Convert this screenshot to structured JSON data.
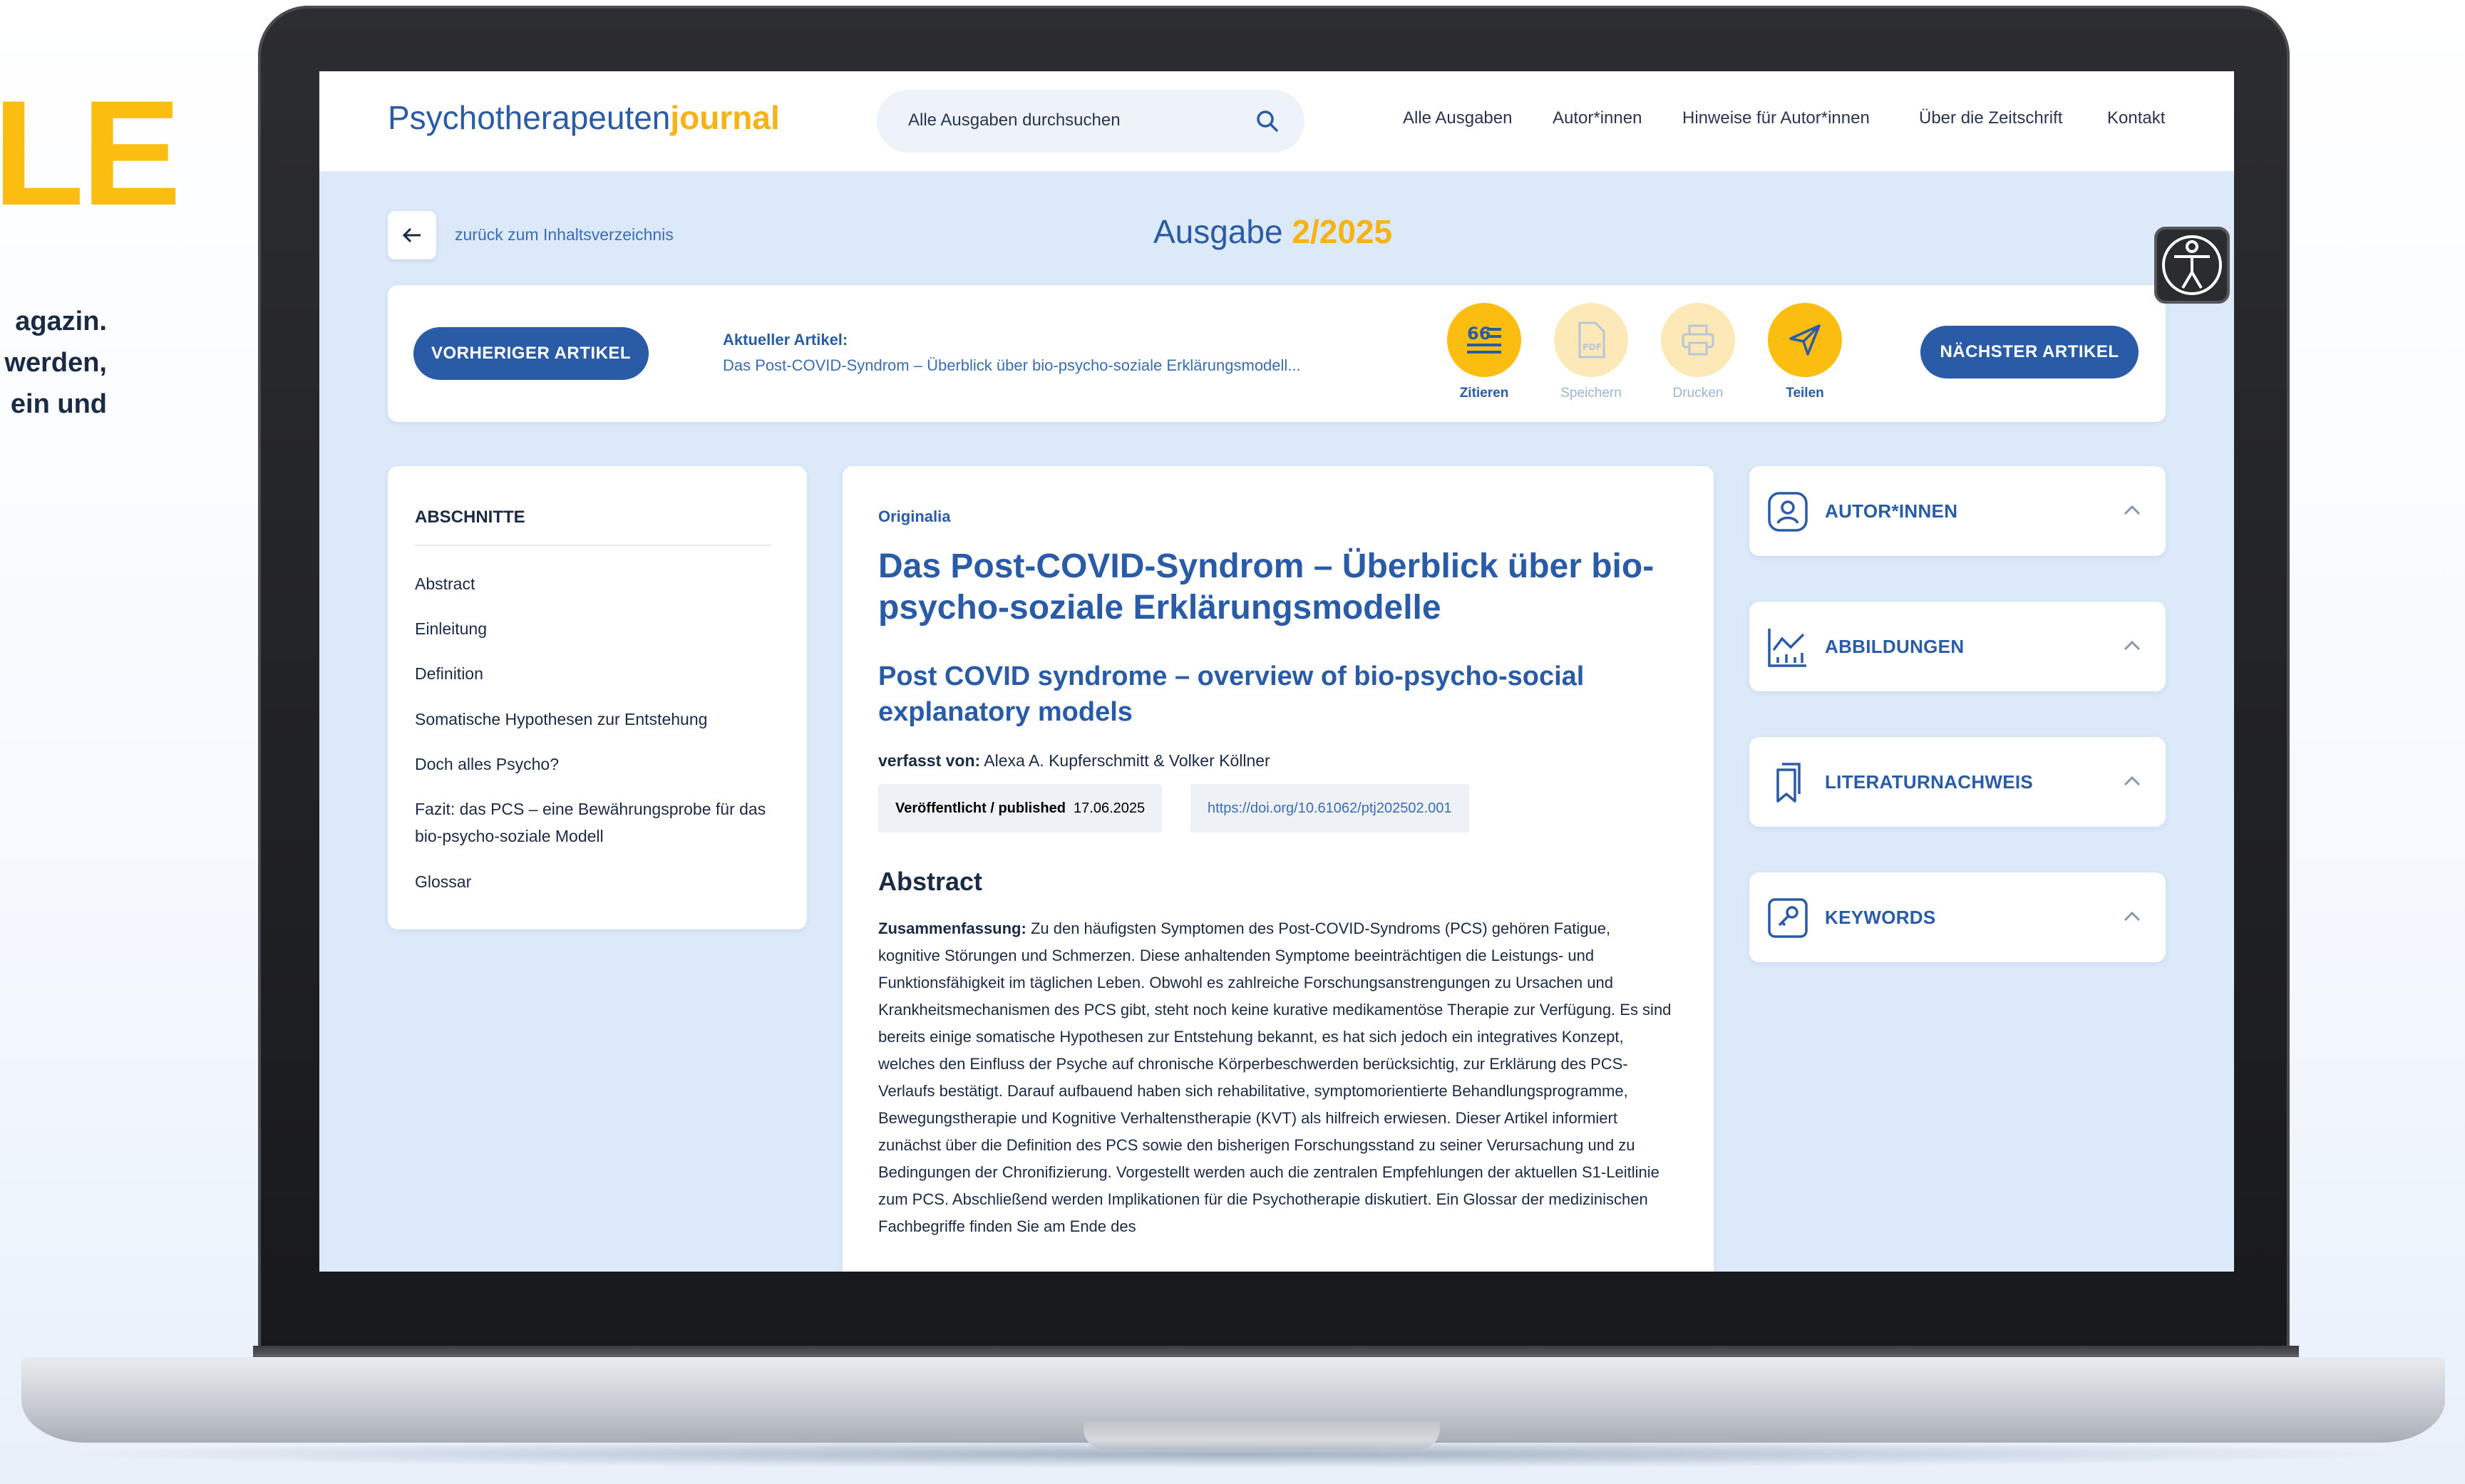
{
  "promo": {
    "title_fragment": "LE",
    "text_lines": [
      "agazin.",
      "werden,",
      "ein und"
    ]
  },
  "header": {
    "logo_main": "Psychotherapeuten",
    "logo_accent": "journal",
    "search_placeholder": "Alle Ausgaben durchsuchen",
    "nav": [
      "Alle Ausgaben",
      "Autor*innen",
      "Hinweise für Autor*innen",
      "Über die Zeitschrift",
      "Kontakt"
    ]
  },
  "issue_bar": {
    "back_label": "zurück zum Inhaltsverzeichnis",
    "issue_prefix": "Ausgabe",
    "issue_number": "2/2025"
  },
  "article_nav": {
    "prev_label": "VORHERIGER ARTIKEL",
    "next_label": "NÄCHSTER ARTIKEL",
    "current_label": "Aktueller Artikel:",
    "current_title": "Das Post-COVID-Syndrom – Überblick über bio-psycho-soziale Erklärungsmodell...",
    "actions": [
      {
        "label": "Zitieren",
        "icon": "quote-icon",
        "enabled": true
      },
      {
        "label": "Speichern",
        "icon": "pdf-icon",
        "enabled": false
      },
      {
        "label": "Drucken",
        "icon": "printer-icon",
        "enabled": false
      },
      {
        "label": "Teilen",
        "icon": "send-icon",
        "enabled": true
      }
    ]
  },
  "toc": {
    "heading": "ABSCHNITTE",
    "items": [
      "Abstract",
      "Einleitung",
      "Definition",
      "Somatische Hypothesen zur Entstehung",
      "Doch alles Psycho?",
      "Fazit: das PCS – eine Bewährungsprobe für das bio-psycho-soziale Modell",
      "Glossar"
    ]
  },
  "article": {
    "rubric": "Originalia",
    "title": "Das Post-COVID-Syndrom – Überblick über bio-psycho-soziale Erklärungsmodelle",
    "subtitle": "Post COVID syndrome – overview of bio-psycho-social explanatory models",
    "authors_label": "verfasst von:",
    "authors": "Alexa A. Kupferschmitt & Volker Köllner",
    "published_label": "Veröffentlicht / published",
    "published_date": "17.06.2025",
    "doi": "https://doi.org/10.61062/ptj202502.001",
    "abstract_heading": "Abstract",
    "abstract_lead": "Zusammenfassung:",
    "abstract_text": "Zu den häufigsten Symptomen des Post-COVID-Syndroms (PCS) gehören Fatigue, kognitive Störungen und Schmerzen. Diese anhaltenden Symptome beeinträchtigen die Leistungs- und Funktionsfähigkeit im täglichen Leben. Obwohl es zahlreiche Forschungsanstrengungen zu Ursachen und Krankheitsmechanismen des PCS gibt, steht noch keine kurative medikamentöse Therapie zur Verfügung. Es sind bereits einige somatische Hypothesen zur Entstehung bekannt, es hat sich jedoch ein integratives Konzept, welches den Einfluss der Psyche auf chronische Körperbeschwerden berücksichtig, zur Erklärung des PCS-Verlaufs bestätigt. Darauf aufbauend haben sich rehabilitative, symptomorientierte Behandlungsprogramme, Bewegungstherapie und Kognitive Verhaltenstherapie (KVT) als hilfreich erwiesen. Dieser Artikel informiert zunächst über die Definition des PCS sowie den bisherigen Forschungsstand zu seiner Verursachung und zu Bedingungen der Chronifizierung. Vorgestellt werden auch die zentralen Empfehlungen der aktuellen S1-Leitlinie zum PCS. Abschließend werden Implikationen für die Psychotherapie diskutiert. Ein Glossar der medizinischen Fachbegriffe finden Sie am Ende des"
  },
  "sidebar": [
    {
      "label": "AUTOR*INNEN",
      "icon": "user-icon"
    },
    {
      "label": "ABBILDUNGEN",
      "icon": "chart-icon"
    },
    {
      "label": "LITERATURNACHWEIS",
      "icon": "bookmark-icon"
    },
    {
      "label": "KEYWORDS",
      "icon": "key-icon"
    }
  ],
  "colors": {
    "brand_blue": "#2a5ba6",
    "accent_yellow": "#fbbd10",
    "screen_bg": "#dbe9f9"
  }
}
